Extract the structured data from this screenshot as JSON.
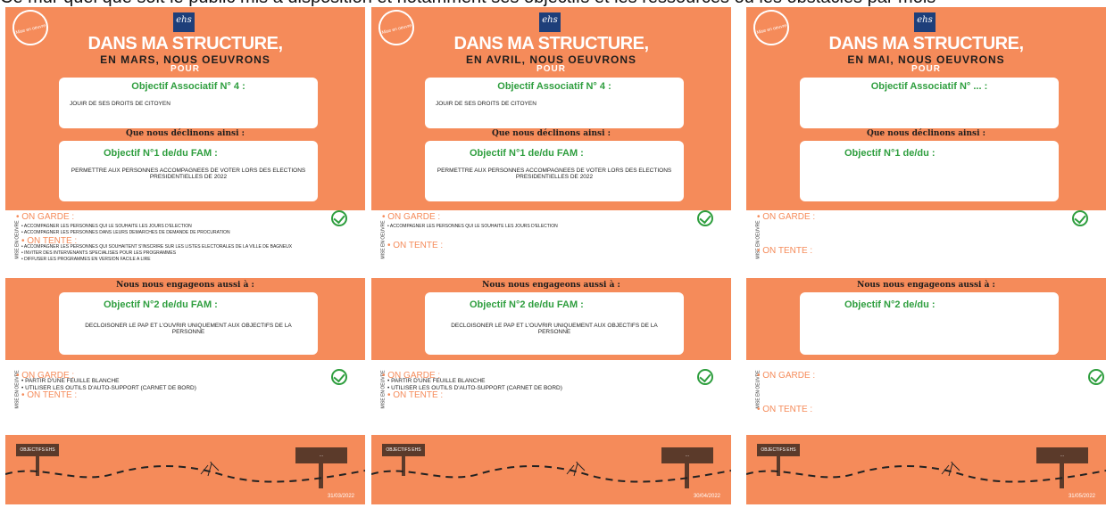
{
  "caption": "Ce mur quel que soit le public mis à disposition et notamment ses objectifs et les ressources ou les obstacles par mois",
  "panels": [
    {
      "badge": "Mise en oeuvre",
      "logo": "ehs",
      "title_main": "DANS MA STRUCTURE,",
      "title_sub": "EN MARS, NOUS OEUVRONS",
      "title_pour": "POUR",
      "obj_assoc_title": "Objectif Associatif N° 4 :",
      "obj_assoc_text": "JOUIR DE SES DROITS DE CITOYEN",
      "declinons": "Que nous déclinons ainsi :",
      "obj1_title": "Objectif N°1 de/du  FAM          :",
      "obj1_text": "PERMETTRE AUX PERSONNES ACCOMPAGNEES DE VOTER LORS DES ELECTIONS PRESIDENTIELLES DE 2022",
      "mid_vert": "MISE EN OEUVRE",
      "garde_label": "• ON GARDE :",
      "garde_items": [
        "• ACCOMPAGNER LES PERSONNES QUI LE SOUHAITE LES JOURS D'ELECTION",
        "• ACCOMPAGNER LES PERSONNES DANS LEURS DEMARCHES DE DEMANDE DE PROCURATION"
      ],
      "tente_label": "• ON TENTE :",
      "tente_items": [
        "• ACCOMPAGNER LES PERSONNES QUI SOUHAITENT S'INSCRIRE SUR LES LISTES ELECTORALES DE LA VILLE DE BAGNEUX",
        "• INVITER DES INTERVENANTS SPECIALISES POUR LES PROGRAMMES",
        "• DIFFUSER LES PROGRAMMES EN VERSION FACILE A LIRE"
      ],
      "engage": "Nous nous engageons aussi à :",
      "obj2_title": "Objectif N°2 de/du  FAM          :",
      "obj2_text": "DECLOISONER LE PAP ET L'OUVRIR UNIQUEMENT AUX OBJECTIFS DE LA PERSONNE",
      "bottom_vert": "MISE EN OEUVRE",
      "bottom_garde_label": "• ON GARDE :",
      "bottom_garde_items": [
        "• PARTIR D'UNE FEUILLE BLANCHE",
        "• UTILISER LES OUTILS D'AUTO-SUPPORT (CARNET DE BORD)"
      ],
      "bottom_tente_label": "• ON TENTE :",
      "footer_sign_left": "OBJECTIFS EHS",
      "footer_sign_right": "...",
      "footer_date": "31/03/2022"
    },
    {
      "badge": "Mise en oeuvre",
      "logo": "ehs",
      "title_main": "DANS MA STRUCTURE,",
      "title_sub": "EN AVRIL, NOUS OEUVRONS",
      "title_pour": "POUR",
      "obj_assoc_title": "Objectif Associatif N° 4 :",
      "obj_assoc_text": "JOUIR DE SES DROITS DE CITOYEN",
      "declinons": "Que nous déclinons ainsi :",
      "obj1_title": "Objectif N°1 de/du  FAM          :",
      "obj1_text": "PERMETTRE AUX PERSONNES ACCOMPAGNEES DE VOTER LORS DES ELECTIONS PRESIDENTIELLES DE 2022",
      "mid_vert": "MISE EN OEUVRE",
      "garde_label": "• ON GARDE :",
      "garde_items": [
        "• ACCOMPAGNER LES PERSONNES QUI LE SOUHAITE LES JOURS D'ELECTION"
      ],
      "tente_label": "• ON TENTE :",
      "tente_items": [],
      "engage": "Nous nous engageons aussi à :",
      "obj2_title": "Objectif N°2 de/du  FAM          :",
      "obj2_text": "DECLOISONER LE PAP ET L'OUVRIR UNIQUEMENT AUX OBJECTIFS DE LA PERSONNE",
      "bottom_vert": "MISE EN OEUVRE",
      "bottom_garde_label": "• ON GARDE :",
      "bottom_garde_items": [
        "• PARTIR D'UNE FEUILLE BLANCHE",
        "• UTILISER LES OUTILS D'AUTO-SUPPORT (CARNET DE BORD)"
      ],
      "bottom_tente_label": "• ON TENTE :",
      "footer_sign_left": "OBJECTIFS EHS",
      "footer_sign_right": "...",
      "footer_date": "30/04/2022"
    },
    {
      "badge": "Mise en oeuvre",
      "logo": "ehs",
      "title_main": "DANS MA STRUCTURE,",
      "title_sub": "EN MAI, NOUS OEUVRONS",
      "title_pour": "POUR",
      "obj_assoc_title": "Objectif Associatif N° ... :",
      "obj_assoc_text": "",
      "declinons": "Que nous déclinons ainsi :",
      "obj1_title": "Objectif N°1 de/du                    :",
      "obj1_text": "",
      "mid_vert": "MISE EN OEUVRE",
      "garde_label": "• ON GARDE :",
      "garde_items": [],
      "tente_label": "• ON TENTE :",
      "tente_items": [],
      "engage": "Nous nous engageons aussi à :",
      "obj2_title": "Objectif N°2 de/du                    :",
      "obj2_text": "",
      "bottom_vert": "MISE EN OEUVRE",
      "bottom_garde_label": "• ON GARDE :",
      "bottom_garde_items": [],
      "bottom_tente_label": "• ON TENTE :",
      "footer_sign_left": "OBJECTIFS EHS",
      "footer_sign_right": "...",
      "footer_date": "31/05/2022"
    }
  ],
  "colors": {
    "orange": "#f58b5a",
    "green": "#2e9e3e",
    "navy": "#1e3f7a",
    "brown": "#5b3a2a"
  }
}
